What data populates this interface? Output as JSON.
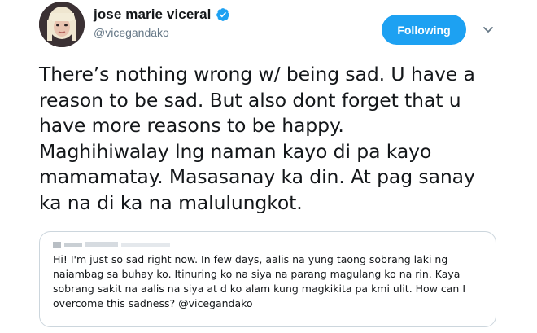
{
  "author": {
    "display_name": "jose marie viceral",
    "handle": "@vicegandako",
    "avatar_icon": "profile-photo-avatar",
    "verified_icon": "verified-badge-icon"
  },
  "actions": {
    "follow_label": "Following",
    "more_icon": "chevron-down-icon"
  },
  "tweet": {
    "lines": [
      "There’s nothing wrong w/ being sad. U have a",
      "reason to be sad. But also dont forget that u",
      "have more reasons to be happy.",
      "Maghihiwalay lng naman kayo di pa kayo",
      "mamamatay. Masasanay ka din. At pag sanay",
      "ka na di ka na malulungkot."
    ]
  },
  "quoted": {
    "lines": [
      "Hi! I'm just so sad right now. In few days, aalis na yung taong sobrang laki ng",
      "naiambag sa buhay ko. Itinuring ko na siya na parang magulang ko na rin. Kaya",
      "sobrang sakit na aalis na siya at d ko alam kung magkikita pa kmi ulit. How can I",
      "overcome this sadness? @vicegandako"
    ]
  },
  "colors": {
    "accent": "#1da1f2",
    "text": "#14171a",
    "secondary": "#657786",
    "border": "#ccd6dd"
  }
}
